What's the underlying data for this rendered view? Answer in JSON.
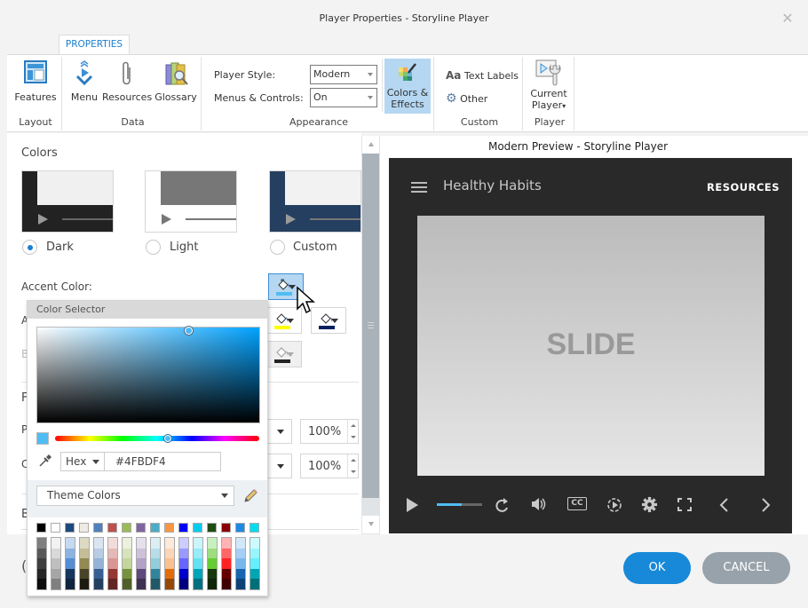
{
  "window": {
    "title": "Player Properties - Storyline Player",
    "close_icon": "close-icon"
  },
  "ribbon": {
    "tab": "PROPERTIES",
    "groups": {
      "layout": {
        "label": "Layout",
        "features": "Features"
      },
      "data": {
        "label": "Data",
        "menu": "Menu",
        "resources": "Resources",
        "glossary": "Glossary"
      },
      "appearance": {
        "label": "Appearance",
        "player_style_label": "Player Style:",
        "player_style_value": "Modern",
        "menus_controls_label": "Menus & Controls:",
        "menus_controls_value": "On",
        "colors_effects_line1": "Colors &",
        "colors_effects_line2": "Effects"
      },
      "custom": {
        "label": "Custom",
        "text_labels": "Text Labels",
        "text_labels_glyph": "Aa",
        "other": "Other"
      },
      "player": {
        "label": "Player",
        "current_line1": "Current",
        "current_line2": "Player"
      }
    }
  },
  "colors_panel": {
    "title": "Colors",
    "themes": [
      {
        "label": "Dark",
        "selected": true
      },
      {
        "label": "Light",
        "selected": false
      },
      {
        "label": "Custom",
        "selected": false
      }
    ],
    "accent_label": "Accent Color:",
    "partial_labels": [
      "A",
      "B",
      "F",
      "P",
      "C",
      "B",
      "("
    ],
    "accent_swatches": {
      "accent": "#4fbdf4",
      "row2_a": "#ffff00",
      "row2_b": "#002060",
      "row3": "#222222"
    },
    "opacity_1": "100%",
    "opacity_2": "100%"
  },
  "color_selector": {
    "header": "Color Selector",
    "format": "Hex",
    "hex_value": "#4FBDF4",
    "current_color": "#4fbdf4",
    "palette_label": "Theme Colors",
    "top_row": [
      "#000000",
      "#ffffff",
      "#1f497d",
      "#eeece1",
      "#4f81bd",
      "#c0504d",
      "#9bbb59",
      "#8064a2",
      "#4bacc6",
      "#f79646",
      "#0000ff",
      "#00ccee",
      "#1e4d13",
      "#8b0000",
      "#1e88e5",
      "#00dcf0"
    ],
    "shades": [
      [
        "#7f7f7f",
        "#595959",
        "#3f3f3f",
        "#262626",
        "#0d0d0d"
      ],
      [
        "#f2f2f2",
        "#d9d9d9",
        "#bfbfbf",
        "#a6a6a6",
        "#808080"
      ],
      [
        "#c6d9f1",
        "#8db3e2",
        "#548dd4",
        "#17365d",
        "#0f243e"
      ],
      [
        "#ddd9c3",
        "#c4bd97",
        "#938953",
        "#494429",
        "#1d1b10"
      ],
      [
        "#dbe5f1",
        "#b8cce4",
        "#95b3d7",
        "#366092",
        "#244061"
      ],
      [
        "#f2dcdb",
        "#e5b9b7",
        "#d99694",
        "#953734",
        "#632423"
      ],
      [
        "#ebf1dd",
        "#d7e3bc",
        "#c3d69b",
        "#76923c",
        "#4f6128"
      ],
      [
        "#e5e0ec",
        "#ccc1d9",
        "#b2a2c7",
        "#5f497a",
        "#3f3151"
      ],
      [
        "#dbeef3",
        "#b7dde8",
        "#92cddc",
        "#31859b",
        "#205867"
      ],
      [
        "#fdeada",
        "#fbd5b5",
        "#fac08f",
        "#e36c09",
        "#974806"
      ],
      [
        "#ccccff",
        "#9999ff",
        "#6666ff",
        "#0000cc",
        "#000080"
      ],
      [
        "#ccf5fb",
        "#99ebf7",
        "#66e1f3",
        "#00a3b8",
        "#007080"
      ],
      [
        "#c9eec0",
        "#9ddd80",
        "#66cc33",
        "#173a0e",
        "#0f2709"
      ],
      [
        "#ffb3b3",
        "#ff6666",
        "#ff2222",
        "#660000",
        "#400000"
      ],
      [
        "#d2e7fa",
        "#a5cff4",
        "#78b7ee",
        "#1565b0",
        "#0d4278"
      ],
      [
        "#ccfafe",
        "#99f5fd",
        "#66effc",
        "#00a6b4",
        "#007078"
      ]
    ]
  },
  "preview": {
    "title": "Modern Preview - Storyline Player",
    "course_title": "Healthy Habits",
    "resources_link": "RESOURCES",
    "slide_text": "SLIDE",
    "seek_progress": 0.55,
    "controls": [
      "play-icon",
      "replay-icon",
      "volume-icon",
      "captions-icon",
      "playback-speed-icon",
      "settings-icon",
      "fullscreen-icon",
      "previous-icon",
      "next-icon"
    ],
    "captions_text": "CC"
  },
  "footer": {
    "ok": "OK",
    "cancel": "CANCEL"
  }
}
